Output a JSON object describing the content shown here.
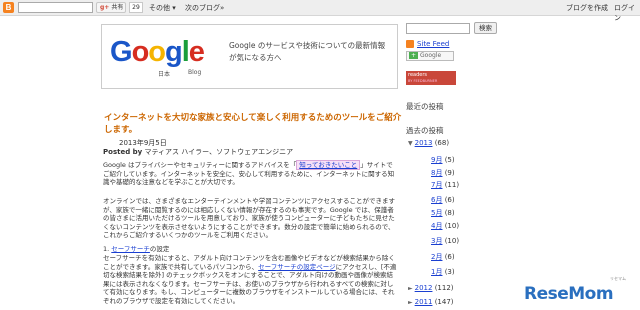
{
  "navbar": {
    "logo_letter": "B",
    "search_button": "共有",
    "count": "29",
    "more": "その他 ▾",
    "next_blog": "次のブログ»",
    "create_blog": "ブログを作成",
    "login": "ログイン"
  },
  "header": {
    "logo_chars": [
      "G",
      "o",
      "o",
      "g",
      "l",
      "e"
    ],
    "logo_sub_left": "日本",
    "logo_sub_right": "Blog",
    "description": "Google のサービスや技術についての最新情報が気になる方へ"
  },
  "post": {
    "title": "インターネットを大切な家族と安心して楽しく利用するためのツールをご紹介します。",
    "date": "2013年9月5日",
    "by_label": "Posted by",
    "author": "マティアス ハイラー、ソフトウェアエンジニア",
    "p1_pre": "Google はプライバシーやセキュリティーに関するアドバイスを「",
    "p1_link": "知っておきたいこと",
    "p1_post": "」サイトでご紹介しています。インターネットを安全に、安心して利用するために、インターネットに関する知識や基礎的な注意などを学ぶことが大切です。",
    "p2": "オンラインでは、さまざまなエンターテインメントや学習コンテンツにアクセスすることができますが、家族で一緒に閲覧するのには相応しくない情報が存在するのも事実です。Google では、保護者の皆さまに活用いただけるツールを用意しており、家族が使うコンピューターに子どもたちに見せたくないコンテンツを表示させないようにすることができます。数分の設定で簡単に始められるので、これからご紹介するいくつかのツールをご利用ください。",
    "item_num": "1.",
    "item_link": "セーフサーチ",
    "item_suffix": "の設定",
    "p3_pre": "セーフサーチを有効にすると、アダルト向けコンテンツを含む画像やビデオなどが検索結果から除くことができます。家族で共有しているパソコンから、",
    "p3_link": "セーフサーチの設定ページ",
    "p3_post": "にアクセスし、[不適切な検索結果を除外] のチェックボックスをオンにすることで、アダルト向けの動画や画像が検索結果には表示されなくなります。セーフサーチは、お使いのブラウザから行われるすべての検索に対して有効になります。もし、コンピューターに複数のブラウザをインストールしている場合には、それぞれのブラウザで設定を有効にしてください。"
  },
  "sidebar": {
    "search_button": "検索",
    "feed_label": "Site Feed",
    "google_button": "Google",
    "readers_label": "readers",
    "readers_sub": "BY FEEDBURNER",
    "recent_posts": "最近の投稿",
    "past_posts": "過去の投稿",
    "year_2013": {
      "marker": "▼",
      "label": "2013",
      "count": "(68)"
    },
    "months": [
      {
        "label": "9月",
        "count": "(5)"
      },
      {
        "label": "8月",
        "count": "(9)"
      },
      {
        "label": "7月",
        "count": "(11)"
      },
      {
        "label": "6月",
        "count": "(6)"
      },
      {
        "label": "5月",
        "count": "(8)"
      },
      {
        "label": "4月",
        "count": "(10)"
      },
      {
        "label": "3月",
        "count": "(10)"
      },
      {
        "label": "2月",
        "count": "(6)"
      },
      {
        "label": "1月",
        "count": "(3)"
      }
    ],
    "year_2012": {
      "marker": "►",
      "label": "2012",
      "count": "(112)"
    },
    "year_2011": {
      "marker": "►",
      "label": "2011",
      "count": "(147)"
    }
  },
  "watermark": {
    "text": "ReseMom",
    "small": "リセマム"
  }
}
